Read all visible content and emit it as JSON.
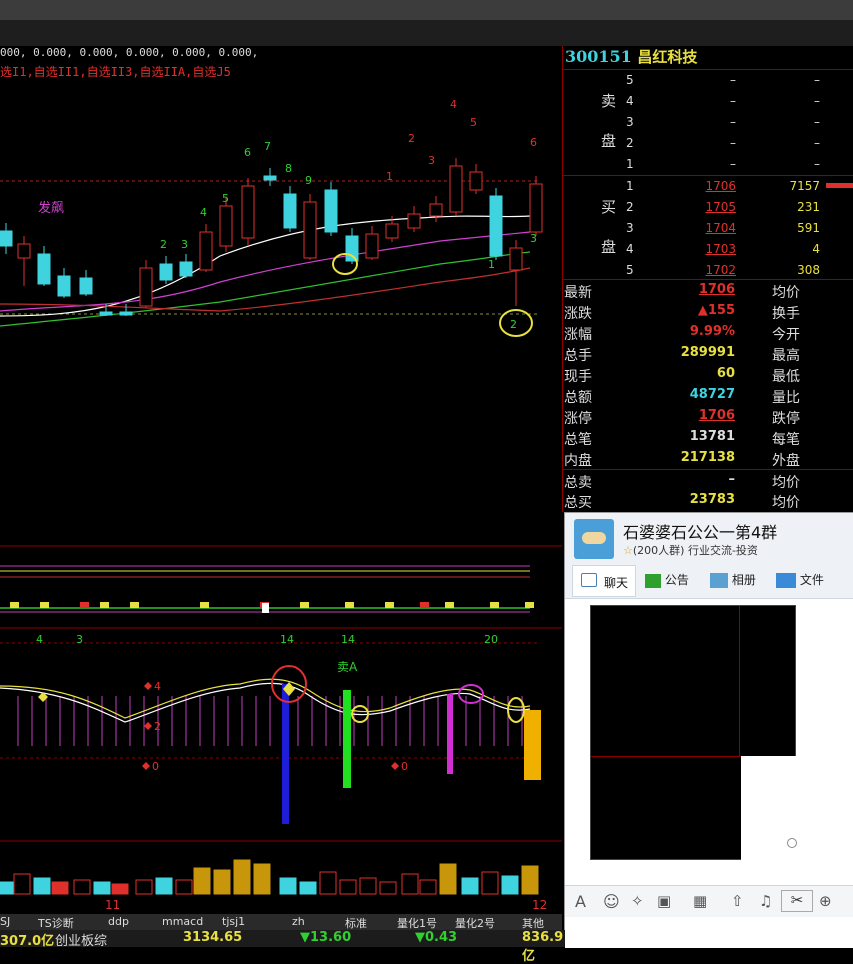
{
  "top_indicator": "000, 0.000, 0.000, 0.000, 0.000, 0.000,",
  "selection_line": "选I1,自选II1,自选II3,自选IIA,自选J5",
  "chart_annotation": "发飙",
  "stock": {
    "code": "300151",
    "name": "昌红科技"
  },
  "order_book": {
    "sell_label": [
      "卖",
      "盘"
    ],
    "buy_label": [
      "买",
      "盘"
    ],
    "sell": [
      {
        "level": "5",
        "price": "–",
        "vol": "–"
      },
      {
        "level": "4",
        "price": "–",
        "vol": "–"
      },
      {
        "level": "3",
        "price": "–",
        "vol": "–"
      },
      {
        "level": "2",
        "price": "–",
        "vol": "–"
      },
      {
        "level": "1",
        "price": "–",
        "vol": "–"
      }
    ],
    "buy": [
      {
        "level": "1",
        "price": "1706",
        "vol": "7157"
      },
      {
        "level": "2",
        "price": "1705",
        "vol": "231"
      },
      {
        "level": "3",
        "price": "1704",
        "vol": "591"
      },
      {
        "level": "4",
        "price": "1703",
        "vol": "4"
      },
      {
        "level": "5",
        "price": "1702",
        "vol": "308"
      }
    ]
  },
  "stats": [
    {
      "label": "最新",
      "value": "1706",
      "label2": "均价",
      "color": "#e0302c"
    },
    {
      "label": "涨跌",
      "value": "▲155",
      "label2": "换手",
      "color": "#e0302c"
    },
    {
      "label": "涨幅",
      "value": "9.99%",
      "label2": "今开",
      "color": "#e0302c"
    },
    {
      "label": "总手",
      "value": "289991",
      "label2": "最高",
      "color": "#e8e040"
    },
    {
      "label": "现手",
      "value": "60",
      "label2": "最低",
      "color": "#e8e040"
    },
    {
      "label": "总额",
      "value": "48727",
      "label2": "量比",
      "color": "#3fd3e0"
    },
    {
      "label": "涨停",
      "value": "1706",
      "label2": "跌停",
      "color": "#e0302c"
    },
    {
      "label": "总笔",
      "value": "13781",
      "label2": "每笔",
      "color": "#dddddd"
    },
    {
      "label": "内盘",
      "value": "217138",
      "label2": "外盘",
      "color": "#e8e040"
    },
    {
      "label": "总卖",
      "value": "–",
      "label2": "均价",
      "color": "#dddddd"
    },
    {
      "label": "总买",
      "value": "23783",
      "label2": "均价",
      "color": "#e8e040"
    }
  ],
  "qq": {
    "group_name": "石婆婆石公公一第4群",
    "group_info": "(200人群) 行业交流-投资",
    "tabs": [
      "聊天",
      "公告",
      "相册",
      "文件"
    ]
  },
  "bottom_tabs": [
    "SJ",
    "TS诊断",
    "ddp",
    "mmacd",
    "tjsj1",
    "zh",
    "标准",
    "量化1号",
    "量化2号",
    "其他"
  ],
  "status": {
    "amount": "307.0亿",
    "board": "创业板综",
    "index": "3134.65",
    "chg": "▼13.60",
    "pct": "▼0.43",
    "right": "836.9亿"
  },
  "axis_labels": {
    "m1": "11",
    "m2": "12"
  },
  "signal_numbers": {
    "top": [
      "6",
      "7",
      "8",
      "9",
      "2",
      "1",
      "4",
      "5",
      "3",
      "6",
      "2",
      "3",
      "4",
      "5",
      "1",
      "2",
      "3"
    ],
    "kdj": [
      "4",
      "3",
      "14",
      "14",
      "20"
    ],
    "kdj_sell": "卖A"
  },
  "colors": {
    "up": "#e0302c",
    "down": "#3fd3e0",
    "yellow": "#e8e040",
    "grid": "#8b0000"
  }
}
